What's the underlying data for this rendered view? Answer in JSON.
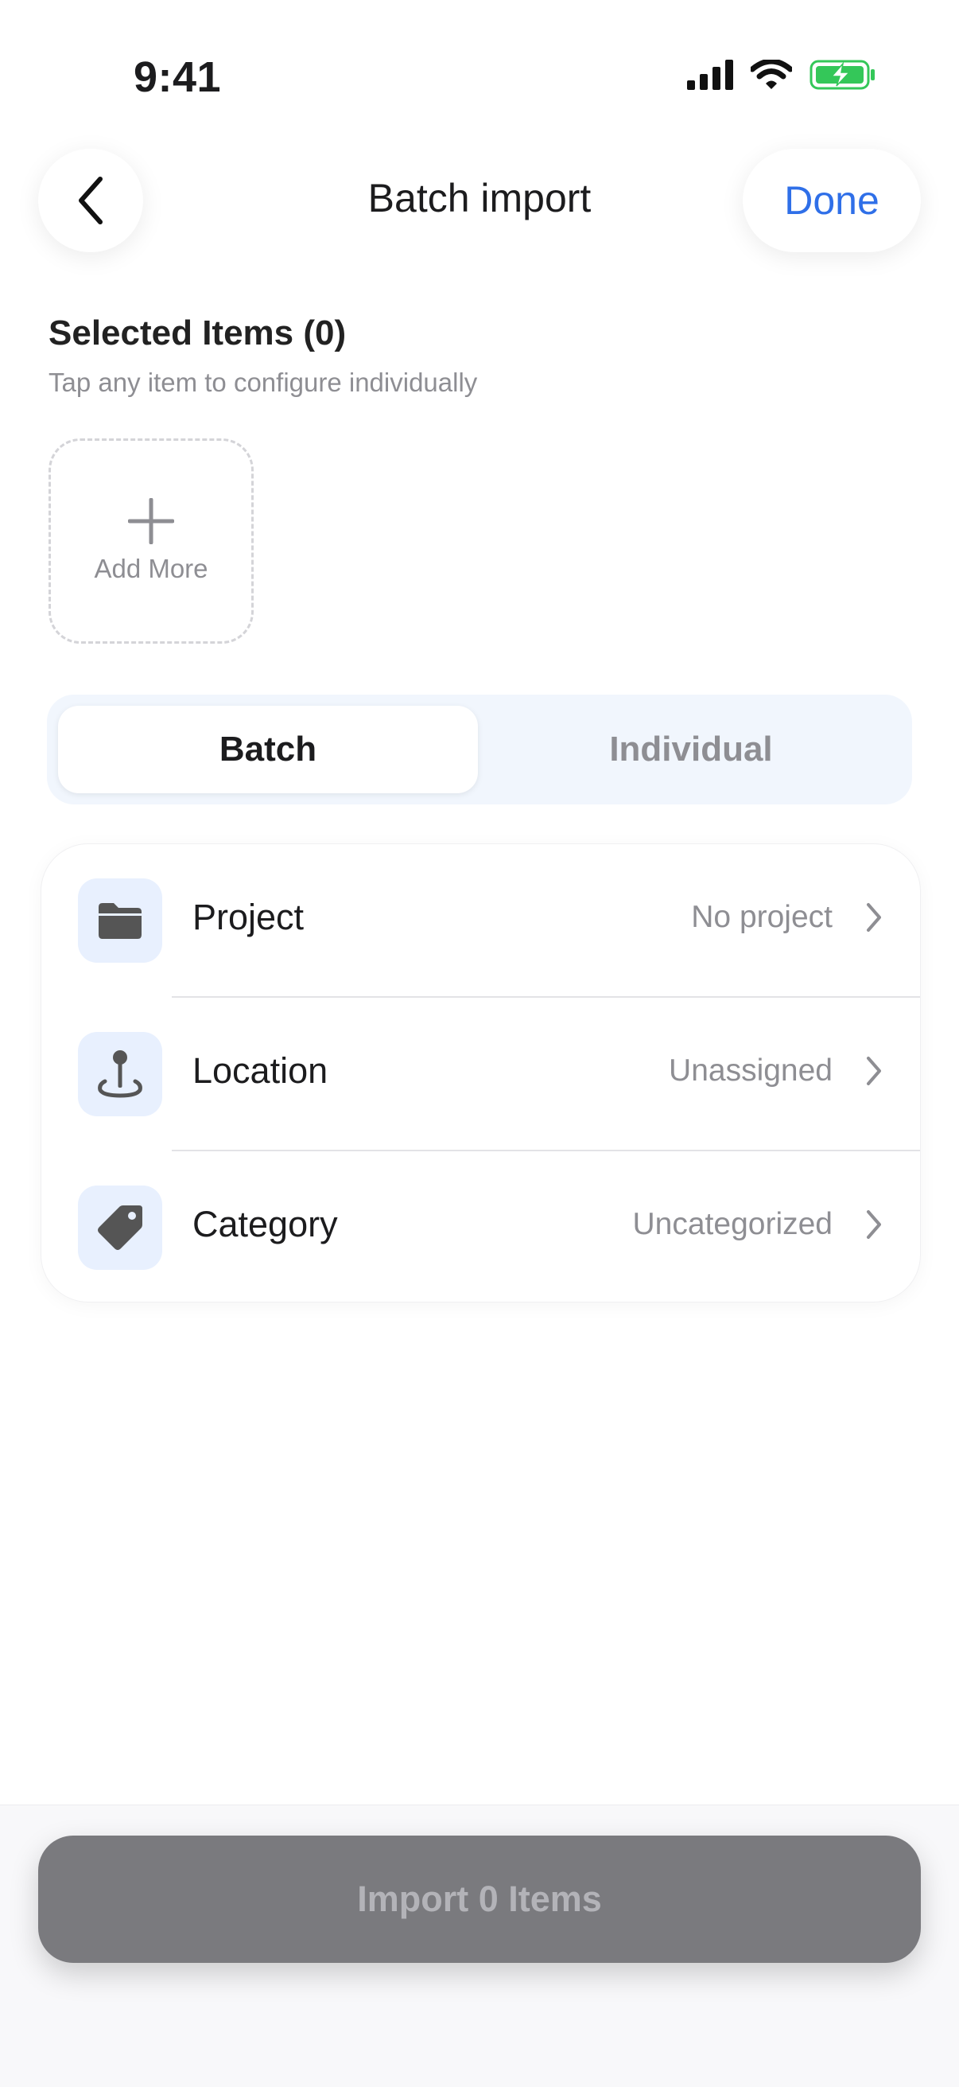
{
  "status_bar": {
    "time": "9:41"
  },
  "nav": {
    "title": "Batch import",
    "done_label": "Done"
  },
  "selected": {
    "title": "Selected Items (0)",
    "subtitle": "Tap any item to configure individually",
    "add_more_label": "Add More"
  },
  "segment": {
    "options": [
      "Batch",
      "Individual"
    ],
    "selected": "Batch"
  },
  "settings": [
    {
      "label": "Project",
      "value": "No project",
      "icon": "folder-icon"
    },
    {
      "label": "Location",
      "value": "Unassigned",
      "icon": "location-pin-icon"
    },
    {
      "label": "Category",
      "value": "Uncategorized",
      "icon": "tag-icon"
    }
  ],
  "import_button": {
    "label": "Import 0 Items"
  },
  "colors": {
    "accent": "#2f6fe8",
    "icon_bg": "#e8f0fe",
    "battery": "#34c759",
    "disabled_button": "#7a7a7e"
  }
}
